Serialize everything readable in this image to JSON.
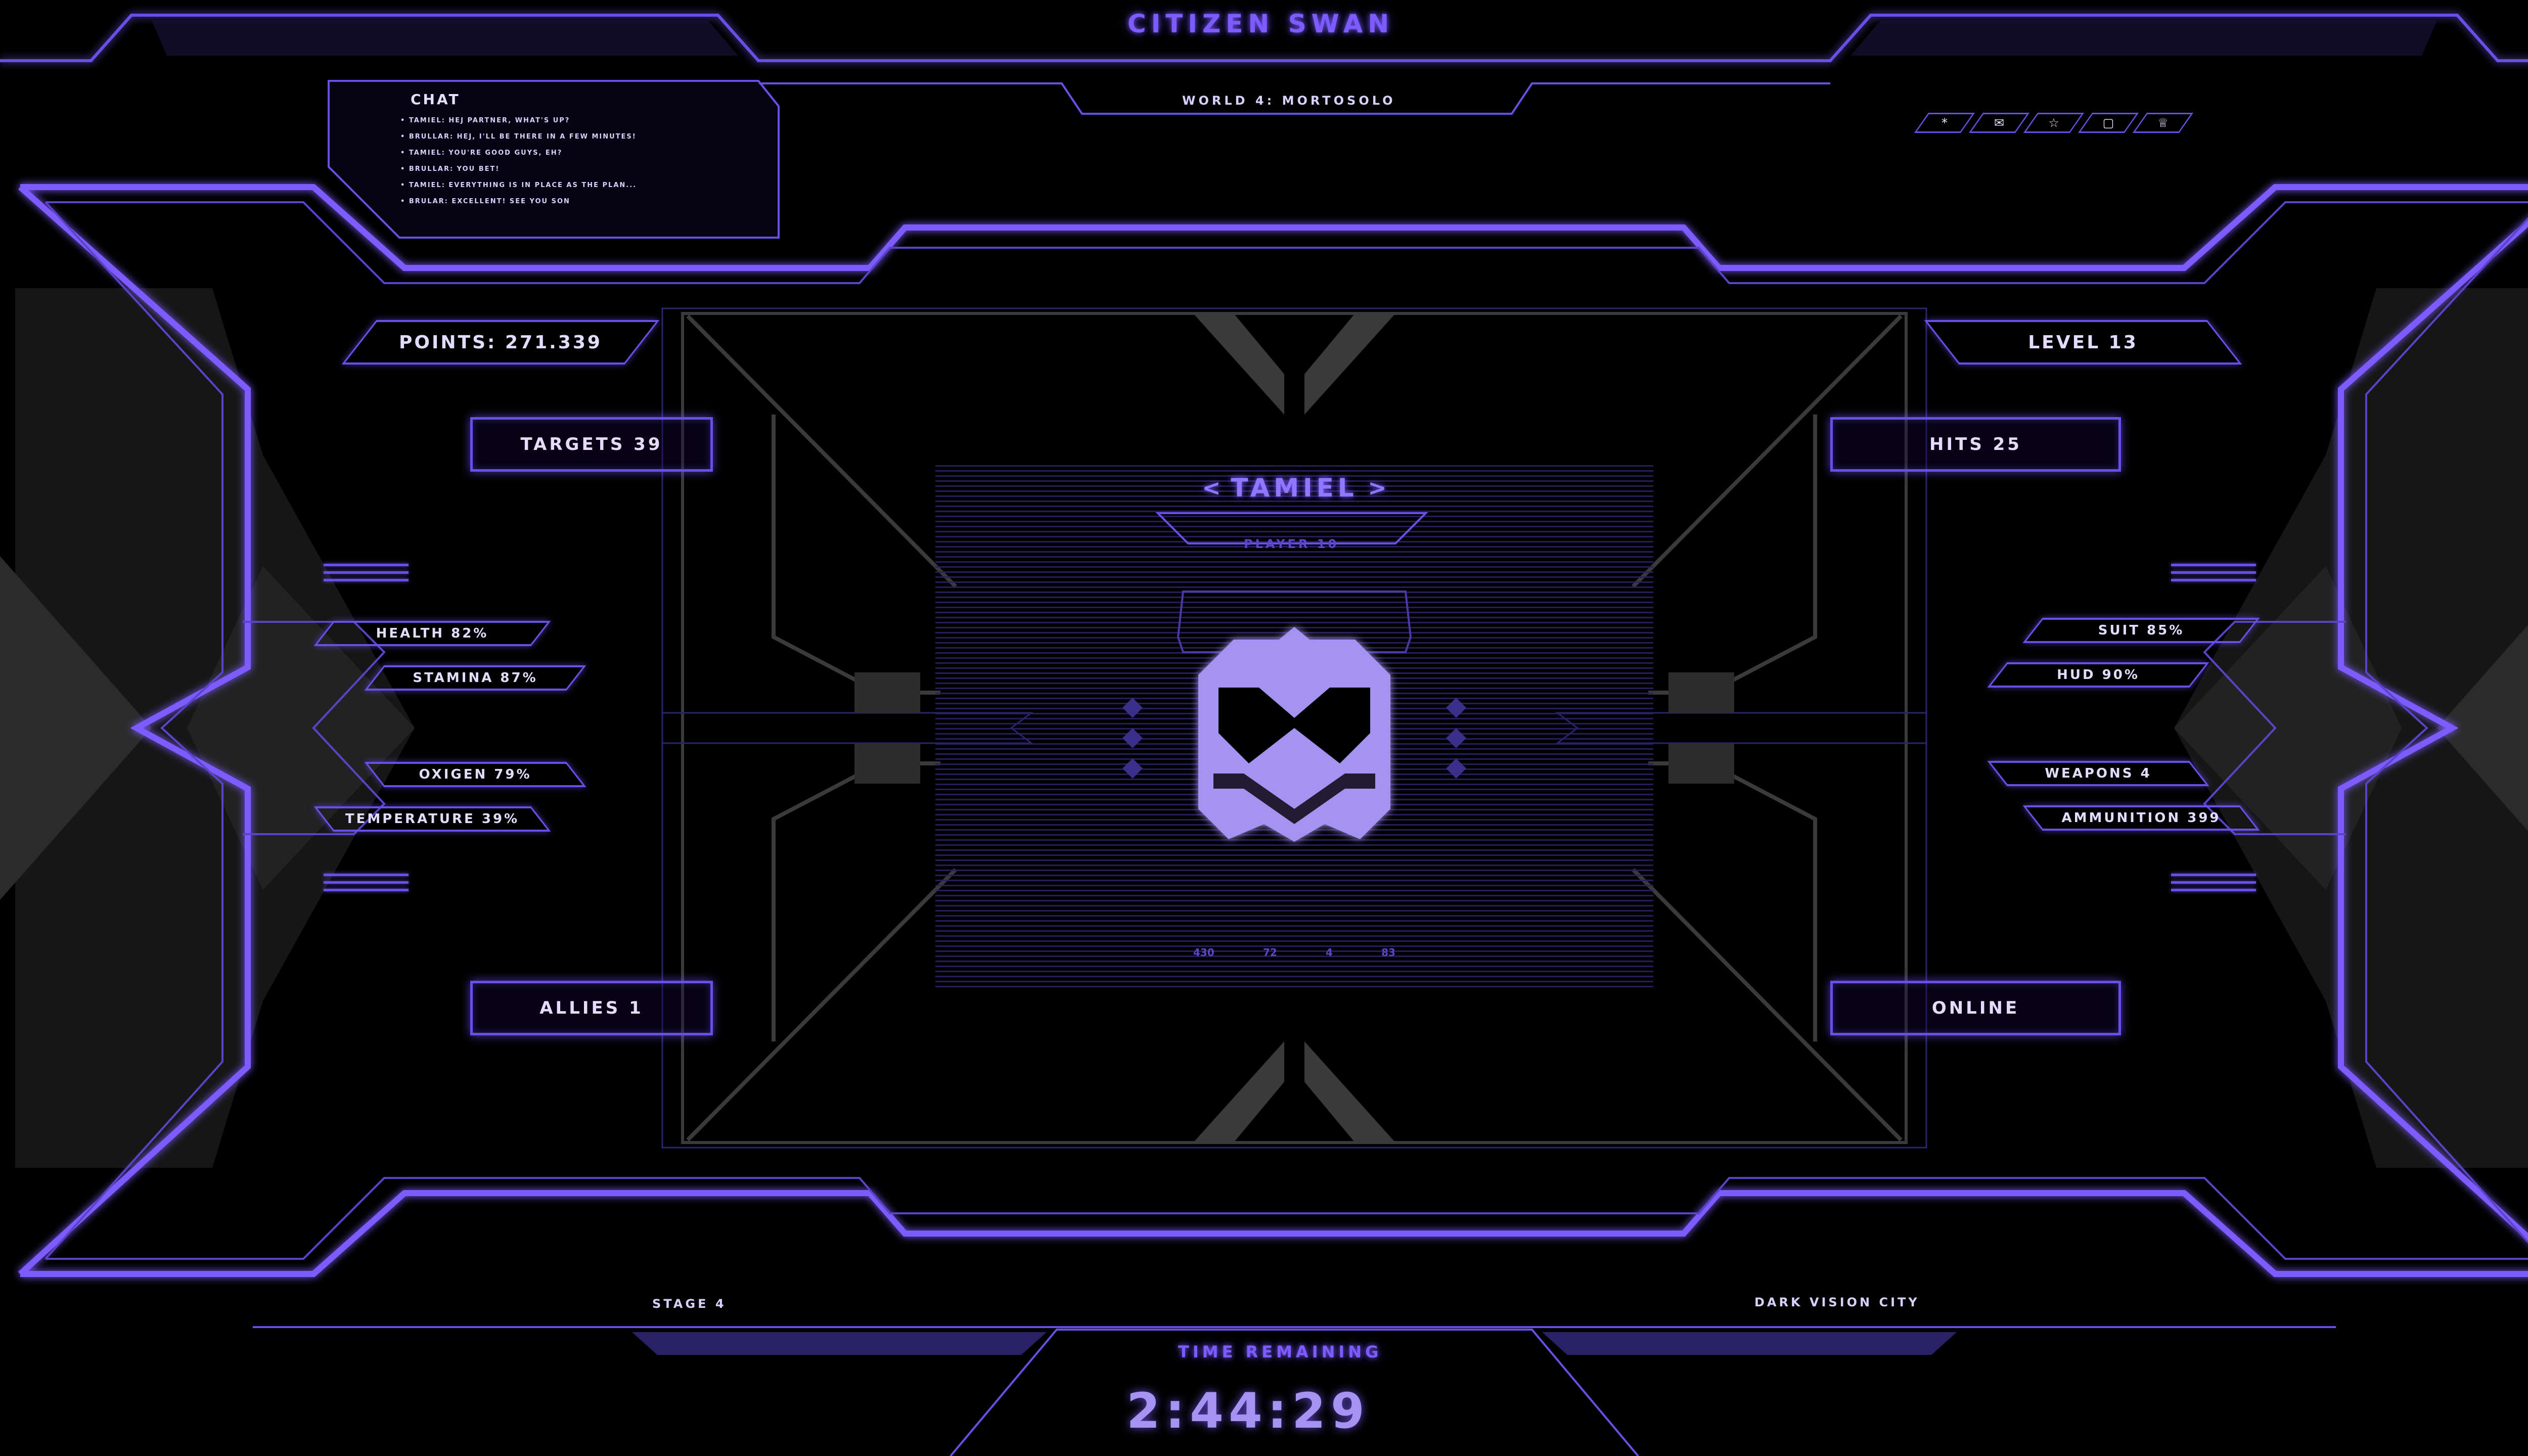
{
  "game_title": "CITIZEN SWAN",
  "world_label": "WORLD 4: MORTOSOLO",
  "chat": {
    "title": "CHAT",
    "messages": [
      "• TAMIEL: HEJ PARTNER, WHAT'S UP?",
      "• BRULLAR: HEJ, I'LL BE THERE IN A FEW MINUTES!",
      "• TAMIEL: YOU'RE GOOD GUYS, EH?",
      "• BRULLAR: YOU BET!",
      "• TAMIEL: EVERYTHING IS IN PLACE AS THE PLAN...",
      "• BRULAR: EXCELLENT! SEE YOU SON"
    ]
  },
  "toolbar_icons": [
    "*",
    "✉",
    "☆",
    "▢",
    "♕"
  ],
  "toolbar_icon_names": [
    "asterisk-icon",
    "mail-icon",
    "star-icon",
    "square-icon",
    "crown-icon"
  ],
  "stats_left": {
    "points": "POINTS: 271.339",
    "targets": "TARGETS 39",
    "health": "HEALTH 82%",
    "stamina": "STAMINA 87%",
    "oxygen": "OXIGEN 79%",
    "temperature": "TEMPERATURE 39%",
    "allies": "ALLIES 1"
  },
  "stats_right": {
    "level": "LEVEL 13",
    "hits": "HITS 25",
    "suit": "SUIT 85%",
    "hud": "HUD 90%",
    "weapons": "WEAPONS 4",
    "ammunition": "AMMUNITION 399",
    "status": "ONLINE"
  },
  "player": {
    "name": "TAMIEL",
    "brackets": [
      "<",
      ">"
    ],
    "id_label": "PLAYER 10",
    "readouts": [
      "430",
      "72",
      "4",
      "83"
    ]
  },
  "footer": {
    "stage": "STAGE 4",
    "location": "DARK VISION CITY",
    "time_label": "TIME REMAINING",
    "time_value": "2:44:29"
  },
  "colors": {
    "accent": "#6a4fe6",
    "accent_bright": "#7c5cff",
    "text": "#c9bdf5",
    "grey": "#3a3a3a",
    "logo": "#a493f0"
  }
}
